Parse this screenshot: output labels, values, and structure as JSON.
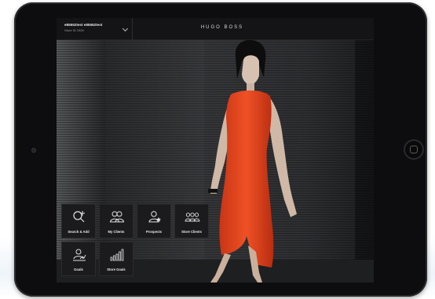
{
  "header": {
    "store_user": "e85552test e85552test",
    "store_id": "Store ID 1905",
    "brand": "HUGO BOSS"
  },
  "tiles": [
    {
      "label": "Search & Add",
      "icon": "search-add-icon"
    },
    {
      "label": "My Clients",
      "icon": "clients-icon"
    },
    {
      "label": "Prospects",
      "icon": "prospect-icon"
    },
    {
      "label": "Store Clients",
      "icon": "store-clients-icon"
    },
    {
      "label": "Goals",
      "icon": "goals-icon"
    },
    {
      "label": "Store Goals",
      "icon": "store-goals-icon"
    }
  ],
  "colors": {
    "dress": "#e0451e",
    "tile_bg": "#1b1b1d",
    "header_bg": "#141416"
  }
}
